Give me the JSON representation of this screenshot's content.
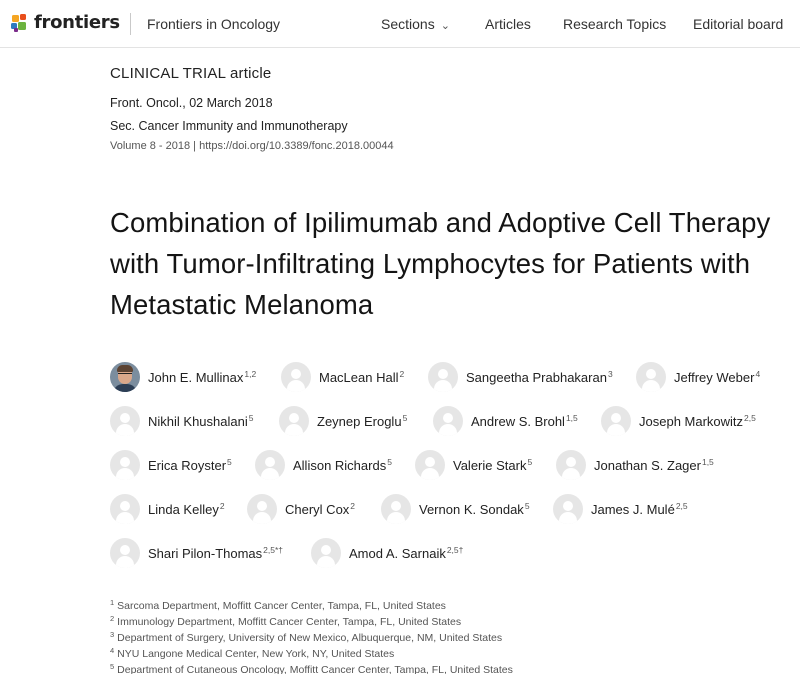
{
  "header": {
    "logo_text": "frontiers",
    "journal": "Frontiers in Oncology",
    "nav": {
      "sections": "Sections",
      "articles": "Articles",
      "research_topics": "Research Topics",
      "editorial_board": "Editorial board"
    }
  },
  "article": {
    "type": "CLINICAL TRIAL article",
    "published": "Front. Oncol., 02 March 2018",
    "section": "Sec. Cancer Immunity and Immunotherapy",
    "volume": "Volume 8 - 2018",
    "separator": " | ",
    "doi": "https://doi.org/10.3389/fonc.2018.00044",
    "title": "Combination of Ipilimumab and Adoptive Cell Therapy with Tumor-Infiltrating Lymphocytes for Patients with Metastatic Melanoma"
  },
  "authors": [
    {
      "name": "John E. Mullinax",
      "sup": "1,2"
    },
    {
      "name": "MacLean Hall",
      "sup": "2"
    },
    {
      "name": "Sangeetha Prabhakaran",
      "sup": "3"
    },
    {
      "name": "Jeffrey Weber",
      "sup": "4"
    },
    {
      "name": "Nikhil Khushalani",
      "sup": "5"
    },
    {
      "name": "Zeynep Eroglu",
      "sup": "5"
    },
    {
      "name": "Andrew S. Brohl",
      "sup": "1,5"
    },
    {
      "name": "Joseph Markowitz",
      "sup": "2,5"
    },
    {
      "name": "Erica Royster",
      "sup": "5"
    },
    {
      "name": "Allison Richards",
      "sup": "5"
    },
    {
      "name": "Valerie Stark",
      "sup": "5"
    },
    {
      "name": "Jonathan S. Zager",
      "sup": "1,5"
    },
    {
      "name": "Linda Kelley",
      "sup": "2"
    },
    {
      "name": "Cheryl Cox",
      "sup": "2"
    },
    {
      "name": "Vernon K. Sondak",
      "sup": "5"
    },
    {
      "name": "James J. Mulé",
      "sup": "2,5"
    },
    {
      "name": "Shari Pilon-Thomas",
      "sup": "2,5*†"
    },
    {
      "name": "Amod A. Sarnaik",
      "sup": "2,5†"
    }
  ],
  "affiliations": [
    {
      "num": "1",
      "text": "Sarcoma Department, Moffitt Cancer Center, Tampa, FL, United States"
    },
    {
      "num": "2",
      "text": "Immunology Department, Moffitt Cancer Center, Tampa, FL, United States"
    },
    {
      "num": "3",
      "text": "Department of Surgery, University of New Mexico, Albuquerque, NM, United States"
    },
    {
      "num": "4",
      "text": "NYU Langone Medical Center, New York, NY, United States"
    },
    {
      "num": "5",
      "text": "Department of Cutaneous Oncology, Moffitt Cancer Center, Tampa, FL, United States"
    }
  ]
}
